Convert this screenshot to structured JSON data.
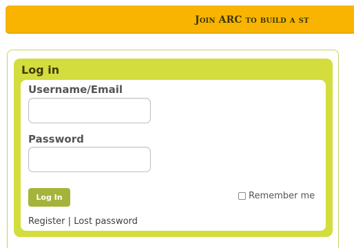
{
  "banner": {
    "text": "Join ARC to build a st"
  },
  "login": {
    "title": "Log in",
    "username_label": "Username/Email",
    "username_value": "",
    "password_label": "Password",
    "password_value": "",
    "submit_label": "Log In",
    "remember_label": "Remember me",
    "remember_checked": false,
    "register_link": "Register",
    "separator": "|",
    "lost_password_link": "Lost password"
  },
  "colors": {
    "banner": "#f8b400",
    "panel": "#d3de3e",
    "button": "#a4b43a"
  }
}
